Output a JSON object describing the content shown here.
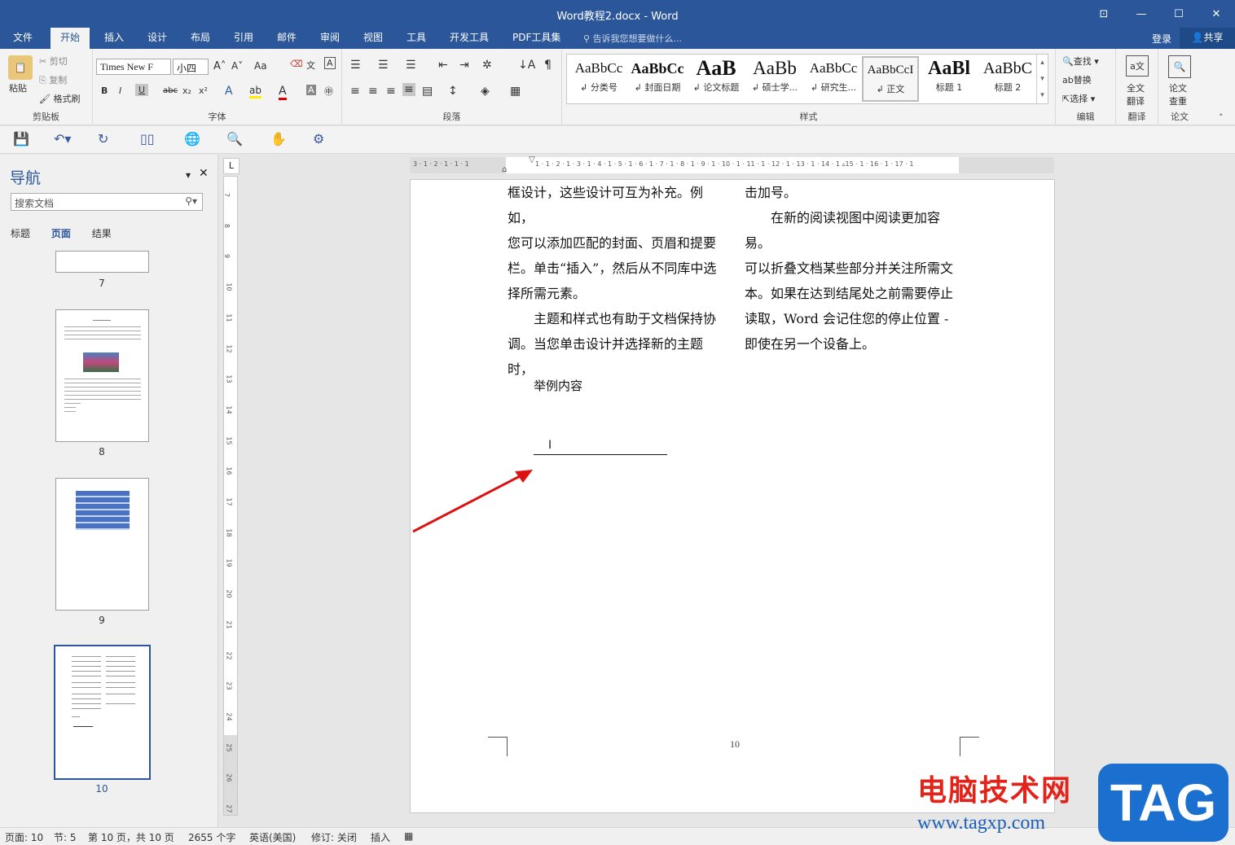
{
  "window": {
    "title": "Word教程2.docx - Word"
  },
  "tabs": [
    "文件",
    "开始",
    "插入",
    "设计",
    "布局",
    "引用",
    "邮件",
    "审阅",
    "视图",
    "工具",
    "开发工具",
    "PDF工具集"
  ],
  "active_tab": "开始",
  "tellme": "告诉我您想要做什么...",
  "login": "登录",
  "share": "共享",
  "ribbon": {
    "clipboard": {
      "paste": "粘贴",
      "cut": "剪切",
      "copy": "复制",
      "format_painter": "格式刷",
      "label": "剪贴板"
    },
    "font": {
      "name": "Times New F",
      "size": "小四",
      "label": "字体",
      "case": "Aa"
    },
    "paragraph": {
      "label": "段落"
    },
    "styles": {
      "label": "样式",
      "items": [
        {
          "preview": "AaBbCc",
          "name": "↲ 分类号"
        },
        {
          "preview": "AaBbCc",
          "name": "↲ 封面日期"
        },
        {
          "preview": "AaB",
          "name": "↲ 论文标题"
        },
        {
          "preview": "AaBb",
          "name": "↲ 硕士学..."
        },
        {
          "preview": "AaBbCc",
          "name": "↲ 研究生..."
        },
        {
          "preview": "AaBbCcI",
          "name": "↲ 正文"
        },
        {
          "preview": "AaBl",
          "name": "标题 1"
        },
        {
          "preview": "AaBbC",
          "name": "标题 2"
        }
      ]
    },
    "editing": {
      "find": "查找",
      "replace": "替换",
      "select": "选择",
      "label": "编辑"
    },
    "translate": {
      "btn1": "全文",
      "btn2": "翻译",
      "label": "翻译"
    },
    "paper": {
      "btn1": "论文",
      "btn2": "查重",
      "label": "论文"
    }
  },
  "nav": {
    "title": "导航",
    "search_placeholder": "搜索文档",
    "tabs": [
      "标题",
      "页面",
      "结果"
    ],
    "active_tab": "页面",
    "pages": [
      "7",
      "8",
      "9",
      "10"
    ],
    "selected_page": "10"
  },
  "document": {
    "left_col": [
      "框设计，这些设计可互为补充。例如，",
      "您可以添加匹配的封面、页眉和提要",
      "栏。单击“插入”，然后从不同库中选",
      "择所需元素。",
      "主题和样式也有助于文档保持协",
      "调。当您单击设计并选择新的主题时，"
    ],
    "right_col": [
      "击加号。",
      "在新的阅读视图中阅读更加容易。",
      "可以折叠文档某些部分并关注所需文",
      "本。如果在达到结尾处之前需要停止",
      "读取，Word 会记住您的停止位置 -",
      "即使在另一个设备上。"
    ],
    "example": "举例内容",
    "page_number": "10"
  },
  "status": {
    "page": "页面: 10",
    "section": "节: 5",
    "pages_of": "第 10 页，共 10 页",
    "words": "2655 个字",
    "lang": "英语(美国)",
    "track": "修订: 关闭",
    "insert": "插入"
  },
  "watermark": {
    "cn": "电脑技术网",
    "url": "www.tagxp.com",
    "tag": "TAG"
  }
}
